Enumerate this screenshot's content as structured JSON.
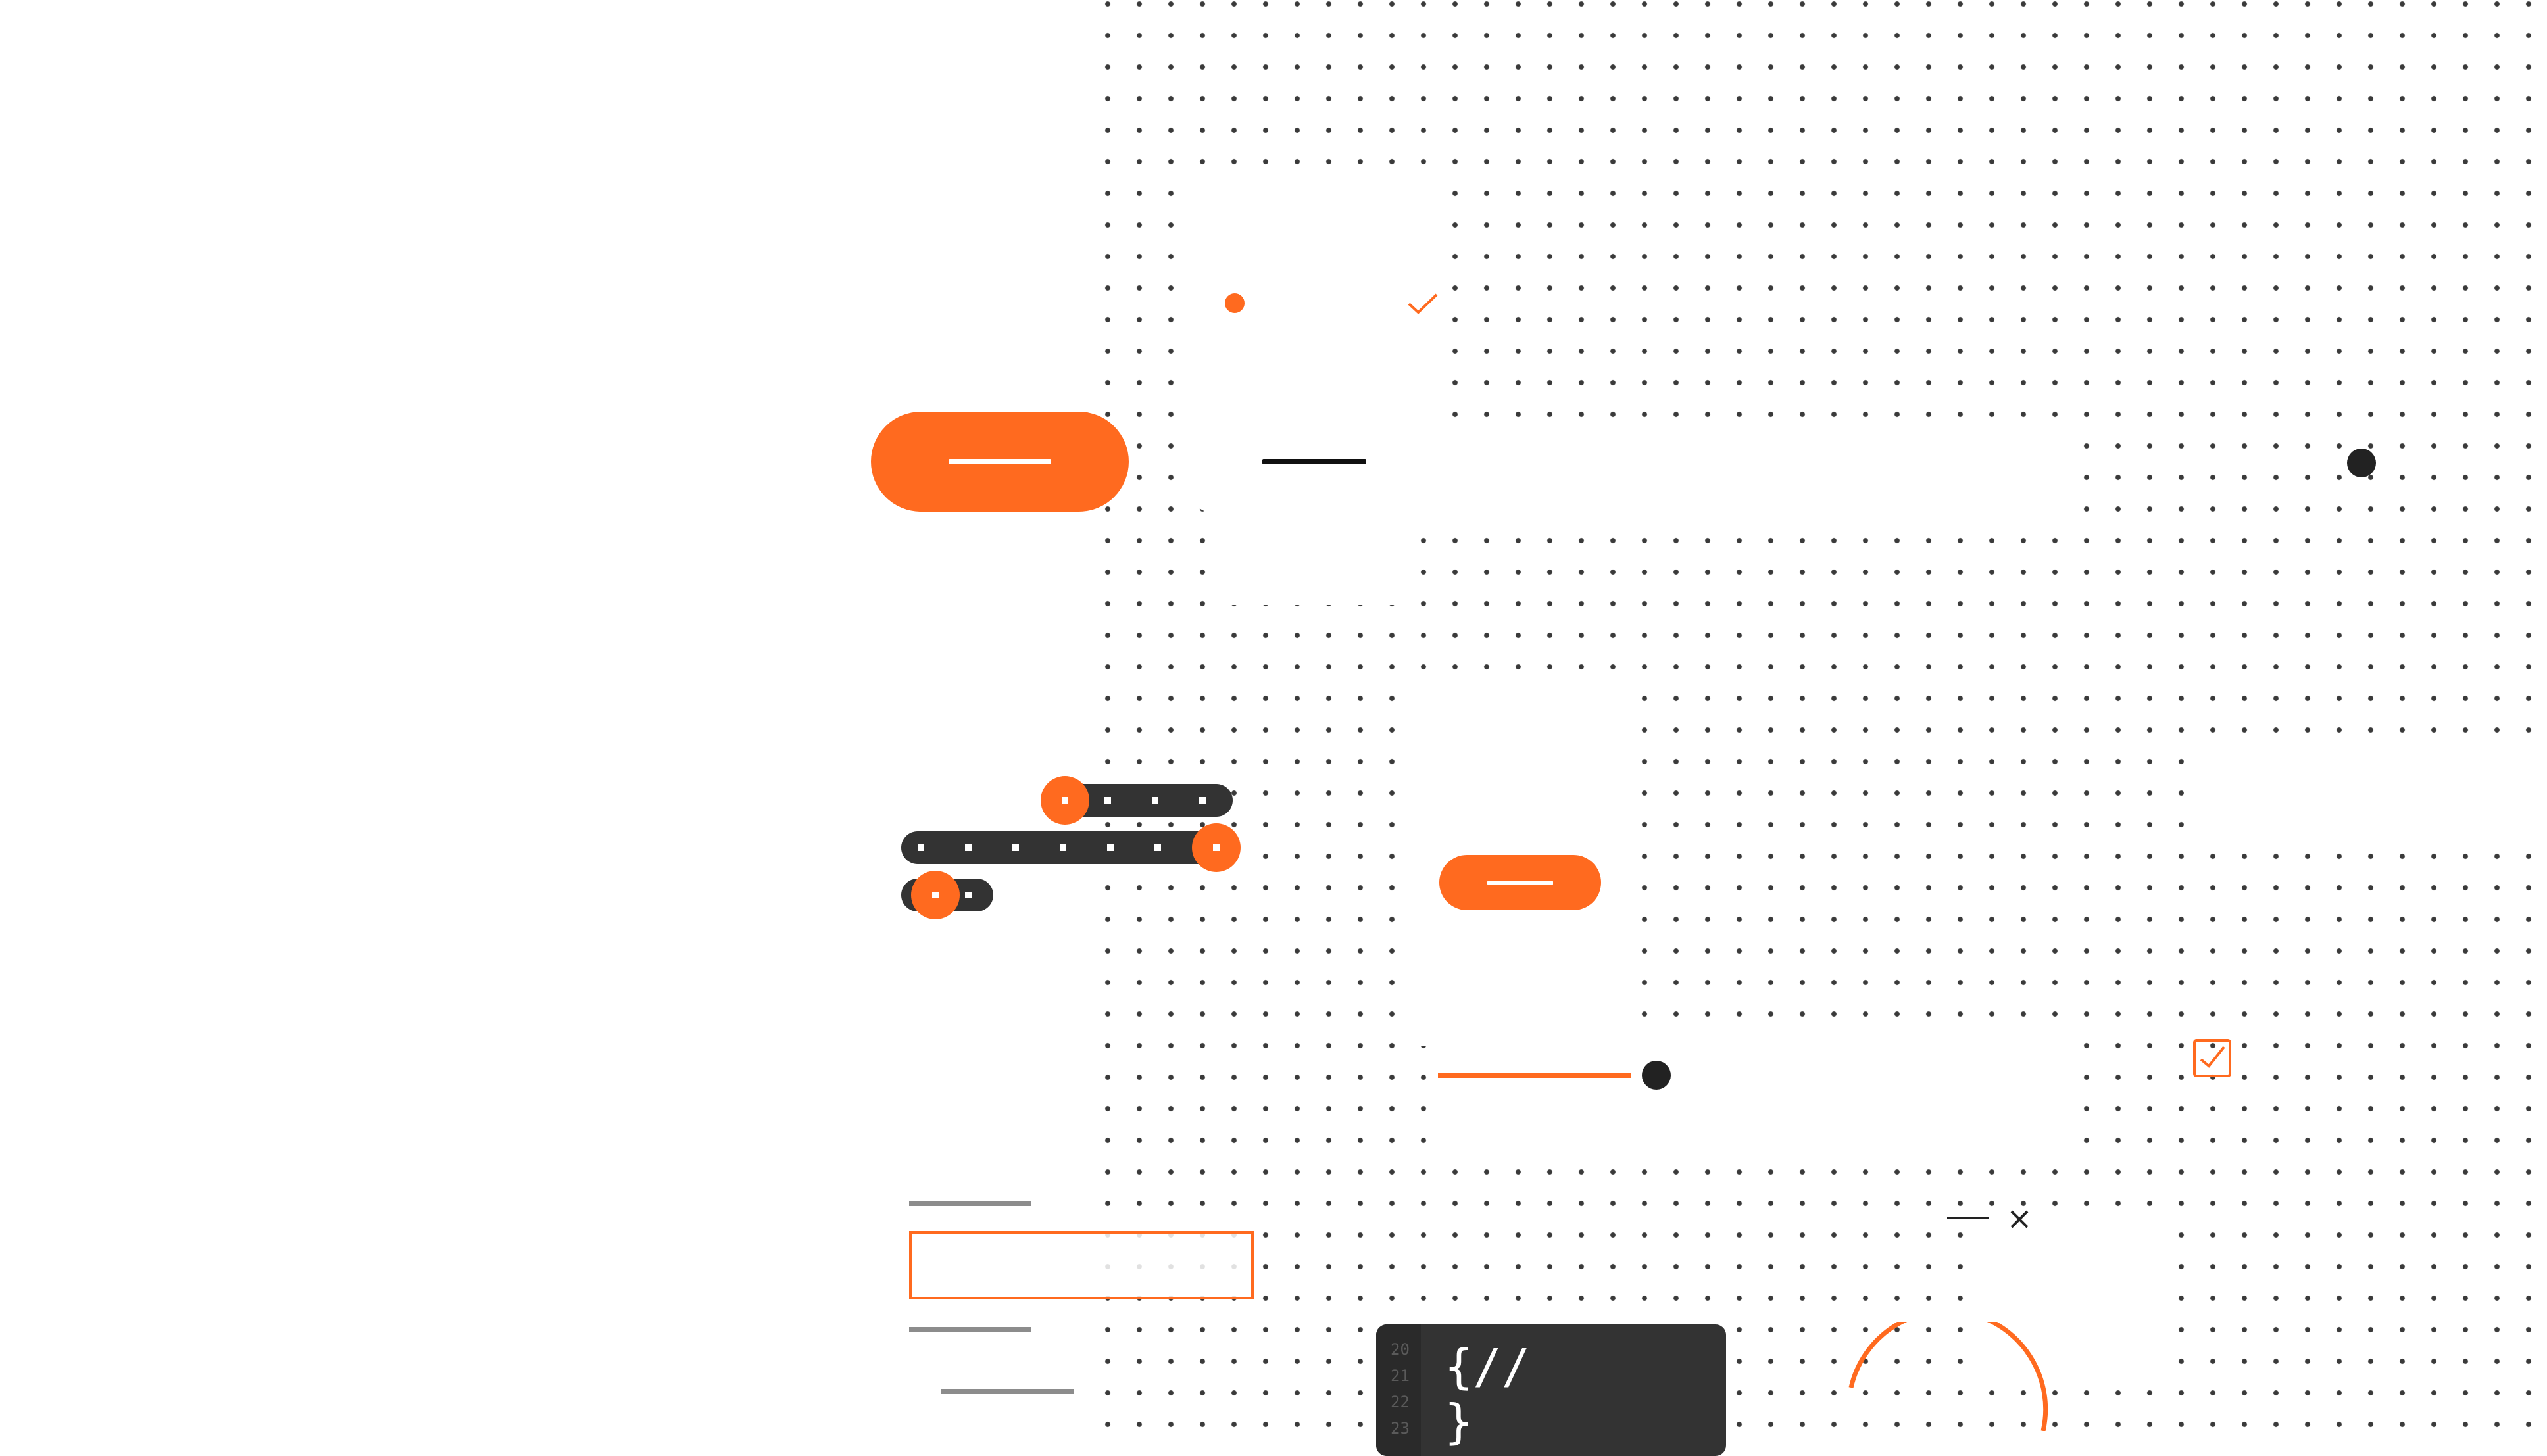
{
  "colors": {
    "accent": "#ff6a1f",
    "dark": "#333333",
    "ink": "#222222",
    "muted_line": "#8c8c8c",
    "background": "#ffffff"
  },
  "icons": {
    "status_dot": "orange-dot-icon",
    "check": "check-icon",
    "radio": "radio-dot-icon",
    "checkbox": "checked-checkbox-icon",
    "minimize": "minimize-icon",
    "close": "close-icon",
    "spinner": "arc-spinner-icon"
  },
  "slider": {
    "value_percent": 75
  },
  "range_sliders": [
    {
      "value_percent": 5
    },
    {
      "value_percent": 100
    },
    {
      "value_percent": 30
    }
  ],
  "checkbox": {
    "checked": true
  },
  "code_editor": {
    "line_numbers": [
      "20",
      "21",
      "22",
      "23"
    ],
    "lines": [
      "{//",
      "}"
    ]
  }
}
